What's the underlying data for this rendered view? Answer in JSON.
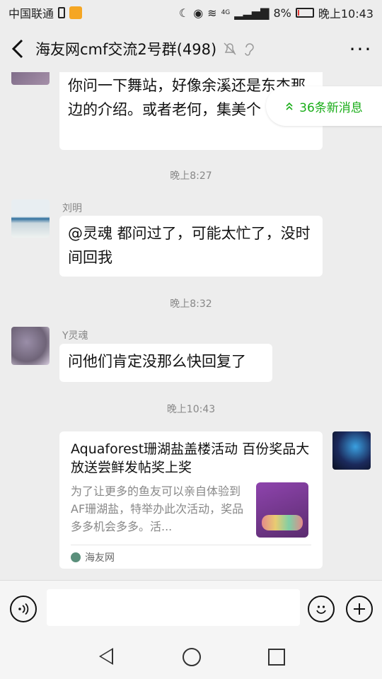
{
  "status_bar": {
    "carrier": "中国联通",
    "network": "4G",
    "battery": "8%",
    "battery_level": 0.08,
    "time": "晚上10:43"
  },
  "header": {
    "title": "海友网cmf交流2号群(498)",
    "more": "···"
  },
  "new_messages_badge": "36条新消息",
  "messages": [
    {
      "text": "你问一下舞站，好像余溪还是东杰那边的介绍。或者老何，集美个"
    },
    {
      "time": "晚上8:27"
    },
    {
      "sender": "刘明",
      "text": "@灵魂  都问过了，可能太忙了，没时间回我"
    },
    {
      "time": "晚上8:32"
    },
    {
      "sender": "Y灵魂",
      "text": "问他们肯定没那么快回复了"
    },
    {
      "time": "晚上10:43"
    }
  ],
  "card": {
    "title": "Aquaforest珊湖盐盖楼活动 百份奖品大放送尝鲜发帖奖上奖",
    "description": "为了让更多的鱼友可以亲自体验到AF珊湖盐，特举办此次活动，奖品多多机会多多。活...",
    "source": "海友网"
  },
  "input": {
    "placeholder": ""
  }
}
